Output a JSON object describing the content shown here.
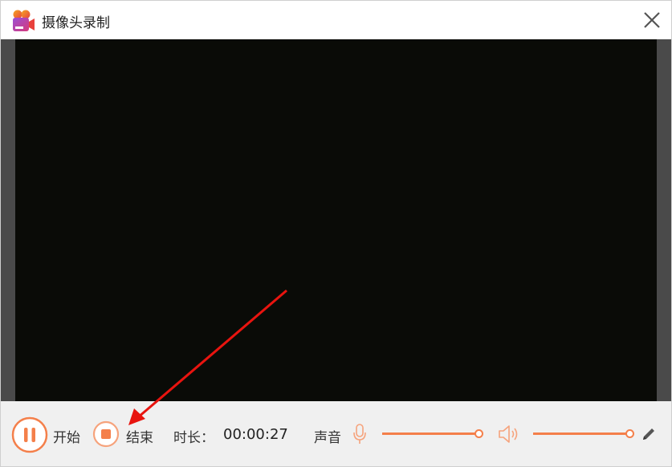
{
  "window": {
    "title": "摄像头录制"
  },
  "controls": {
    "start_label": "开始",
    "stop_label": "结束",
    "duration_label": "时长：",
    "duration_value": "00:00:27",
    "sound_label": "声音",
    "mic_volume": 1.0,
    "speaker_volume": 1.0
  },
  "colors": {
    "accent": "#f47f4a",
    "video_bg": "#0a0b07",
    "control_bg": "#f0f0f0"
  },
  "icons": [
    "app-camera-icon",
    "close-icon",
    "pause-icon",
    "stop-icon",
    "microphone-icon",
    "speaker-icon",
    "pencil-icon"
  ]
}
